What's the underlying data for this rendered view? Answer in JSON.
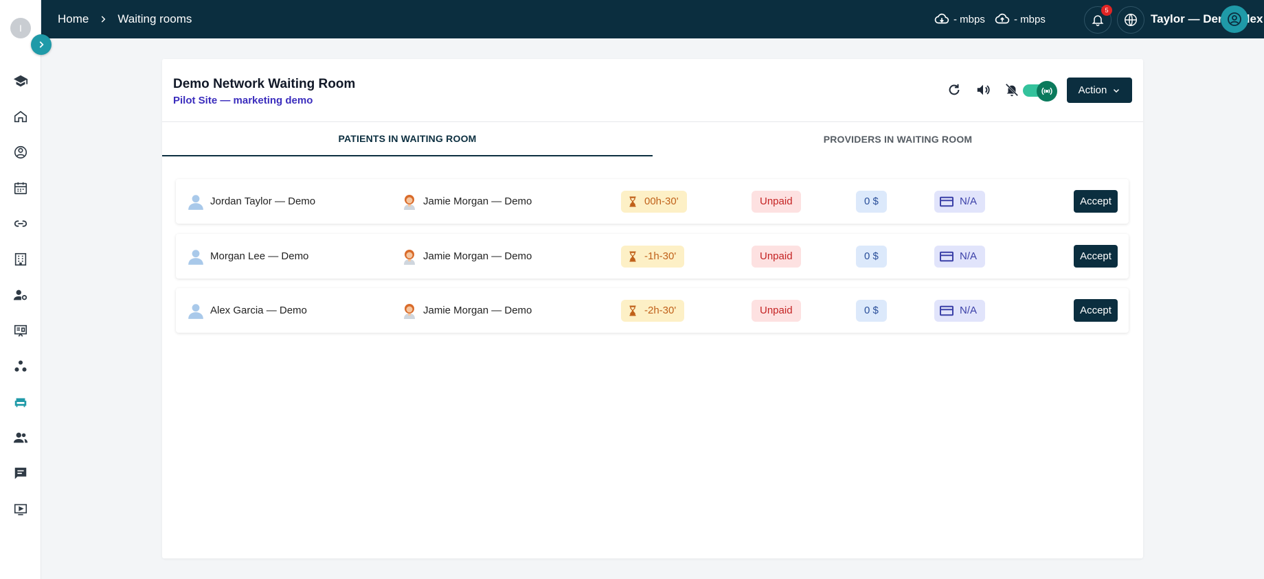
{
  "sidebar": {
    "avatar_initial": "I",
    "accent": "#1f9aa8",
    "items": [
      {
        "icon": "graduation-cap-icon"
      },
      {
        "icon": "home-icon"
      },
      {
        "icon": "doctor-icon"
      },
      {
        "icon": "calendar-icon"
      },
      {
        "icon": "link-icon"
      },
      {
        "icon": "building-icon"
      },
      {
        "icon": "user-settings-icon"
      },
      {
        "icon": "presentation-icon"
      },
      {
        "icon": "network-icon"
      },
      {
        "icon": "sofa-icon",
        "active": true
      },
      {
        "icon": "group-icon"
      },
      {
        "icon": "chat-icon"
      },
      {
        "icon": "video-icon"
      }
    ]
  },
  "topbar": {
    "breadcrumb": {
      "home": "Home",
      "current": "Waiting rooms"
    },
    "download_speed": "- mbps",
    "upload_speed": "- mbps",
    "notification_count": "5",
    "user_name": "Taylor — Demo Alex"
  },
  "room": {
    "title": "Demo Network Waiting Room",
    "subtitle": "Pilot Site — marketing demo",
    "action_label": "Action",
    "toggle_on": true
  },
  "tabs": [
    {
      "label": "PATIENTS IN WAITING ROOM",
      "active": true
    },
    {
      "label": "PROVIDERS IN WAITING ROOM",
      "active": false
    }
  ],
  "patients": [
    {
      "patient": "Jordan Taylor — Demo",
      "provider": "Jamie Morgan — Demo",
      "wait": "00h-30'",
      "status": "Unpaid",
      "amount": "0 $",
      "payment": "N/A",
      "action": "Accept"
    },
    {
      "patient": "Morgan Lee — Demo",
      "provider": "Jamie Morgan — Demo",
      "wait": "-1h-30'",
      "status": "Unpaid",
      "amount": "0 $",
      "payment": "N/A",
      "action": "Accept"
    },
    {
      "patient": "Alex Garcia — Demo",
      "provider": "Jamie Morgan — Demo",
      "wait": "-2h-30'",
      "status": "Unpaid",
      "amount": "0 $",
      "payment": "N/A",
      "action": "Accept"
    }
  ]
}
